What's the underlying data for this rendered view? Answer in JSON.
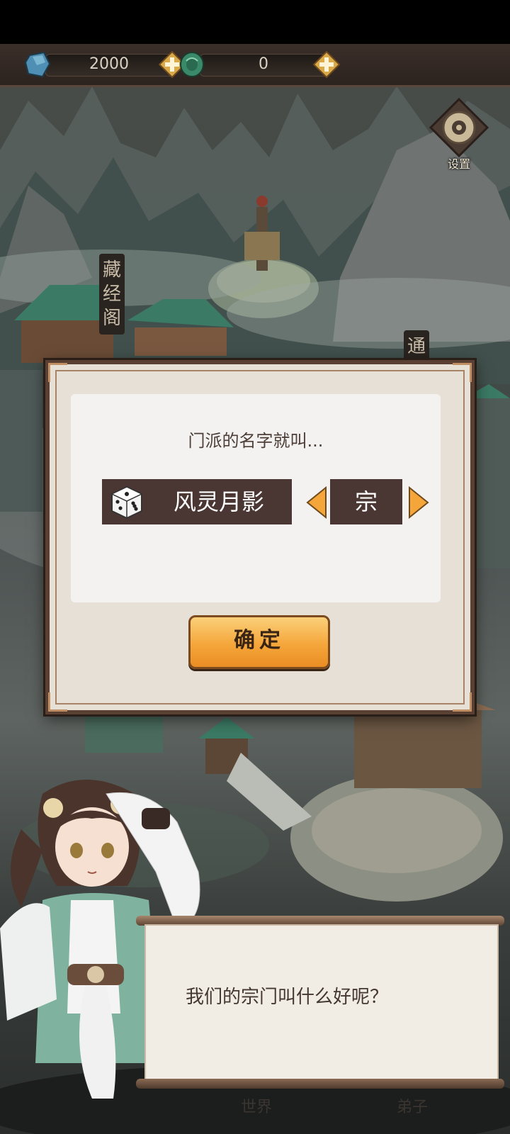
{
  "currencies": [
    {
      "icon": "blue-gem-icon",
      "value": "2000"
    },
    {
      "icon": "jade-coin-icon",
      "value": "0"
    }
  ],
  "settings": {
    "label": "设置"
  },
  "map": {
    "signs": [
      {
        "text": "藏经阁"
      },
      {
        "text": "通"
      },
      {
        "text": "世界"
      },
      {
        "text": "弟子"
      }
    ]
  },
  "dialog": {
    "prompt": "门派的名字就叫...",
    "name": "风灵月影",
    "suffix": "宗",
    "confirm_label": "确定"
  },
  "speech": {
    "text": "我们的宗门叫什么好呢？"
  },
  "colors": {
    "dialog_bg": "#e6e0d7",
    "name_box": "#4a3733",
    "confirm_button": "#f5a63a",
    "arrow": "#f5a63a"
  }
}
